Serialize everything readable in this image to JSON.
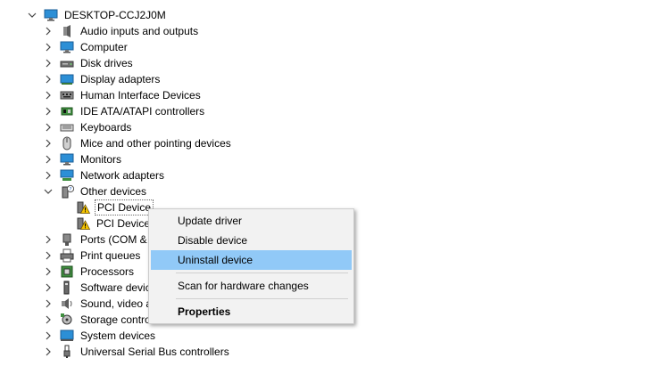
{
  "tree": {
    "root": {
      "label": "DESKTOP-CCJ2J0M",
      "icon": "computer-root-icon"
    },
    "categories": [
      {
        "label": "Audio inputs and outputs",
        "icon": "speaker-icon",
        "expanded": false
      },
      {
        "label": "Computer",
        "icon": "monitor-icon",
        "expanded": false
      },
      {
        "label": "Disk drives",
        "icon": "disk-drive-icon",
        "expanded": false
      },
      {
        "label": "Display adapters",
        "icon": "display-adapter-icon",
        "expanded": false
      },
      {
        "label": "Human Interface Devices",
        "icon": "hid-icon",
        "expanded": false
      },
      {
        "label": "IDE ATA/ATAPI controllers",
        "icon": "ide-controller-icon",
        "expanded": false
      },
      {
        "label": "Keyboards",
        "icon": "keyboard-icon",
        "expanded": false
      },
      {
        "label": "Mice and other pointing devices",
        "icon": "mouse-icon",
        "expanded": false
      },
      {
        "label": "Monitors",
        "icon": "monitor-icon",
        "expanded": false
      },
      {
        "label": "Network adapters",
        "icon": "network-icon",
        "expanded": false
      },
      {
        "label": "Other devices",
        "icon": "unknown-device-icon",
        "expanded": true
      },
      {
        "label": "Ports (COM &",
        "icon": "port-icon",
        "expanded": false
      },
      {
        "label": "Print queues",
        "icon": "printer-icon",
        "expanded": false
      },
      {
        "label": "Processors",
        "icon": "processor-icon",
        "expanded": false
      },
      {
        "label": "Software devic",
        "icon": "software-device-icon",
        "expanded": false
      },
      {
        "label": "Sound, video a",
        "icon": "sound-icon",
        "expanded": false
      },
      {
        "label": "Storage contro",
        "icon": "storage-icon",
        "expanded": false
      },
      {
        "label": "System devices",
        "icon": "system-device-icon",
        "expanded": false
      },
      {
        "label": "Universal Serial Bus controllers",
        "icon": "usb-icon",
        "expanded": false
      }
    ],
    "other_devices_children": [
      {
        "label": "PCI Device",
        "icon": "warning-device-icon",
        "selected": true
      },
      {
        "label": "PCI Device",
        "icon": "warning-device-icon",
        "selected": false
      }
    ]
  },
  "context_menu": {
    "items": [
      {
        "label": "Update driver"
      },
      {
        "label": "Disable device"
      },
      {
        "label": "Uninstall device",
        "highlighted": true
      },
      {
        "label": "Scan for hardware changes"
      },
      {
        "label": "Properties",
        "bold": true
      }
    ]
  },
  "colors": {
    "menu_highlight": "#91c9f7",
    "menu_background": "#f2f2f2",
    "warning": "#f5c400"
  }
}
